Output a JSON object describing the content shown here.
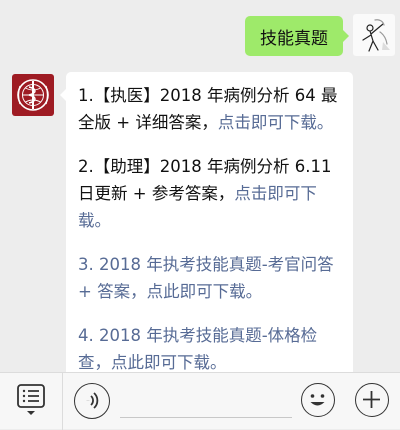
{
  "outgoing_message": {
    "text": "技能真题"
  },
  "incoming_message": {
    "items": [
      {
        "prefix": "1.【执医】2018 年病例分析 64 最全版 + 详细答案，",
        "link": "点击即可下载。"
      },
      {
        "prefix": "2.【助理】2018 年病例分析 6.11 日更新 + 参考答案，",
        "link": "点击即可下载。"
      },
      {
        "text": "3. 2018 年执考技能真题-考官问答 + 答案，点此即可下载。"
      },
      {
        "text": "4. 2018 年执考技能真题-体格检查，点此即可下载。"
      }
    ]
  },
  "toolbar": {
    "icons": [
      "menu-icon",
      "voice-icon",
      "emoji-icon",
      "plus-icon"
    ]
  },
  "colors": {
    "background": "#ededed",
    "outgoing_bubble": "#9eea6a",
    "incoming_bubble": "#ffffff",
    "link": "#576b95",
    "avatar_brand": "#9e1b23"
  }
}
